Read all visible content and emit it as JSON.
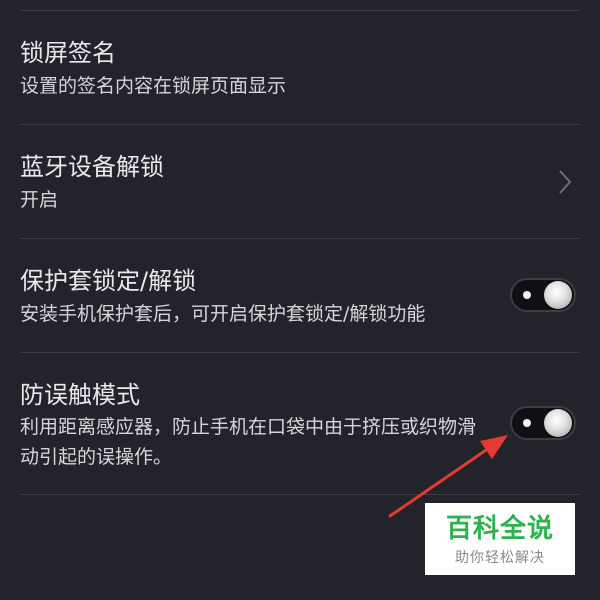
{
  "settings": {
    "items": [
      {
        "title": "锁屏签名",
        "subtitle": "设置的签名内容在锁屏页面显示"
      },
      {
        "title": "蓝牙设备解锁",
        "subtitle": "开启",
        "control": "chevron-right-icon"
      },
      {
        "title": "保护套锁定/解锁",
        "subtitle": "安装手机保护套后，可开启保护套锁定/解锁功能",
        "control": "toggle",
        "enabled": false
      },
      {
        "title": "防误触模式",
        "subtitle": "利用距离感应器，防止手机在口袋中由于挤压或织物滑动引起的误操作。",
        "control": "toggle",
        "enabled": false
      }
    ]
  },
  "annotation": {
    "arrow_color": "#e53935",
    "icon": "red-arrow-icon"
  },
  "watermark": {
    "title": "百科全说",
    "subtitle": "助你轻松解决",
    "color": "#2fb14f"
  }
}
